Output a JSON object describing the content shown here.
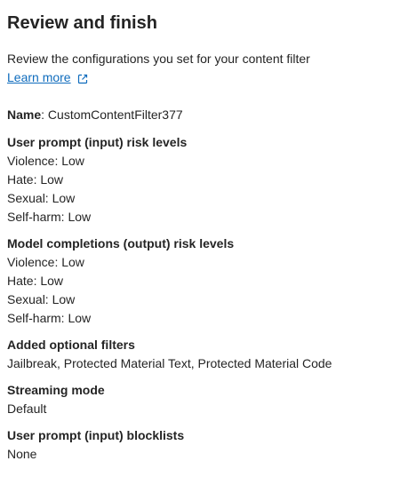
{
  "header": {
    "title": "Review and finish"
  },
  "intro": {
    "text": "Review the configurations you set for your content filter",
    "learn_more": "Learn more",
    "learn_more_icon": "external-link-icon"
  },
  "name": {
    "label": "Name",
    "separator": ": ",
    "value": "CustomContentFilter377"
  },
  "input_risk": {
    "title": "User prompt (input) risk levels",
    "items": [
      "Violence: Low",
      "Hate: Low",
      "Sexual: Low",
      "Self-harm: Low"
    ]
  },
  "output_risk": {
    "title": "Model completions (output) risk levels",
    "items": [
      "Violence: Low",
      "Hate: Low",
      "Sexual: Low",
      "Self-harm: Low"
    ]
  },
  "optional_filters": {
    "title": "Added optional filters",
    "value": "Jailbreak, Protected Material Text, Protected Material Code"
  },
  "streaming": {
    "title": "Streaming mode",
    "value": "Default"
  },
  "blocklists": {
    "title": "User prompt (input) blocklists",
    "value": "None"
  },
  "colors": {
    "text": "#242424",
    "link": "#0f6cbd",
    "background": "#ffffff"
  }
}
